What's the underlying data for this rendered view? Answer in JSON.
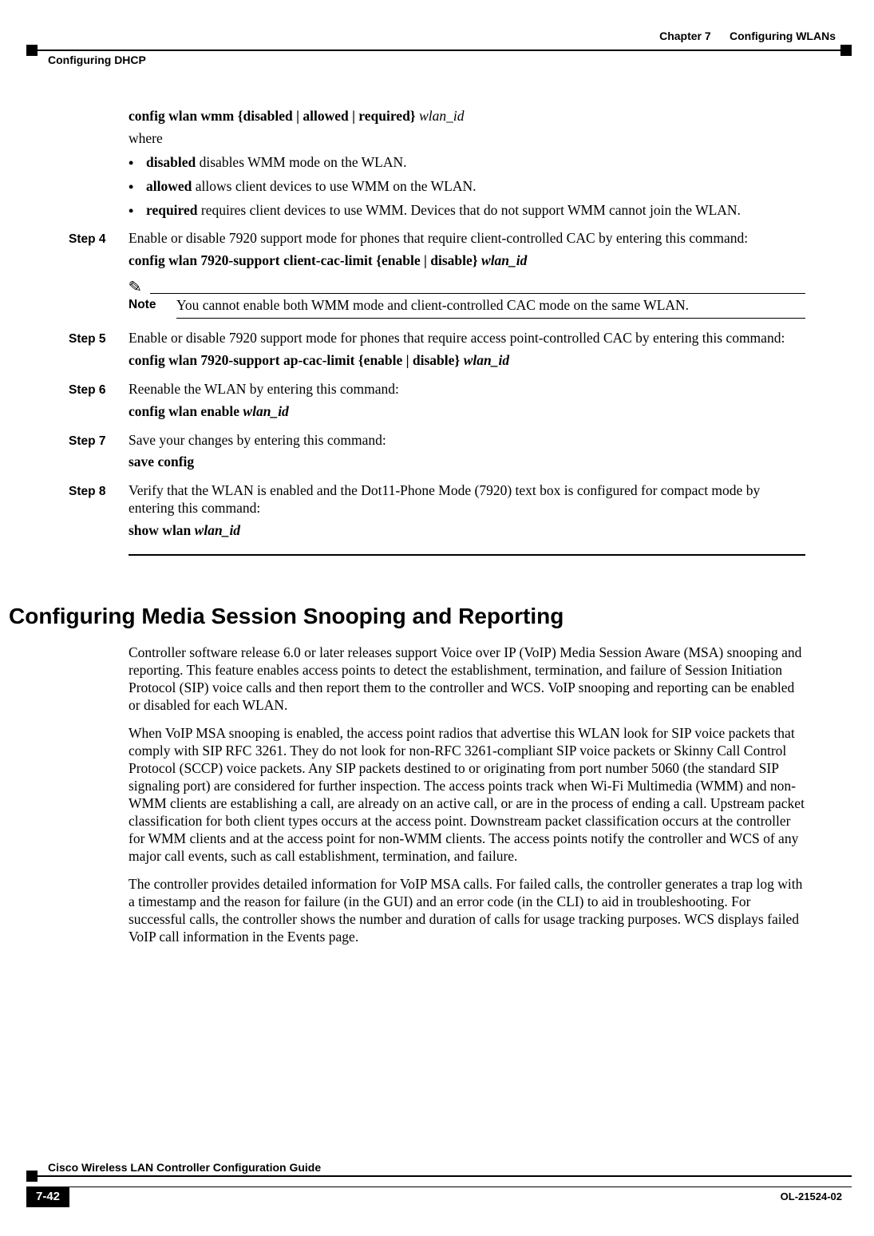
{
  "header": {
    "chapter": "Chapter 7      Configuring WLANs",
    "section": "Configuring DHCP"
  },
  "content": {
    "cmd_wmm_pre": "config wlan wmm",
    "cmd_wmm_opts": " {disabled | allowed | required} ",
    "cmd_wmm_arg": "wlan_id",
    "where": "where",
    "bul1_b": "disabled",
    "bul1_t": " disables WMM mode on the WLAN.",
    "bul2_b": "allowed",
    "bul2_t": " allows client devices to use WMM on the WLAN.",
    "bul3_b": "required",
    "bul3_t": " requires client devices to use WMM. Devices that do not support WMM cannot join the WLAN.",
    "step4_label": "Step 4",
    "step4_text": "Enable or disable 7920 support mode for phones that require client-controlled CAC by entering this command:",
    "step4_cmd_pre": "config wlan 7920-support client-cac-limit",
    "step4_cmd_opts": " {enable | disable} ",
    "step4_cmd_arg": "wlan_id",
    "note_label": "Note",
    "note_text": "You cannot enable both WMM mode and client-controlled CAC mode on the same WLAN.",
    "step5_label": "Step 5",
    "step5_text": "Enable or disable 7920 support mode for phones that require access point-controlled CAC by entering this command:",
    "step5_cmd_pre": "config wlan 7920-support ap-cac-limit",
    "step5_cmd_opts": " {enable | disable} ",
    "step5_cmd_arg": "wlan_id",
    "step6_label": "Step 6",
    "step6_text": "Reenable the WLAN by entering this command:",
    "step6_cmd_pre": "config wlan enable ",
    "step6_cmd_arg": "wlan_id",
    "step7_label": "Step 7",
    "step7_text": "Save your changes by entering this command:",
    "step7_cmd": "save config",
    "step8_label": "Step 8",
    "step8_text": "Verify that the WLAN is enabled and the Dot11-Phone Mode (7920) text box is configured for compact mode by entering this command:",
    "step8_cmd_pre": "show wlan ",
    "step8_cmd_arg": "wlan_id",
    "h2": "Configuring Media Session Snooping and Reporting",
    "p1": "Controller software release 6.0 or later releases support Voice over IP (VoIP) Media Session Aware (MSA) snooping and reporting. This feature enables access points to detect the establishment, termination, and failure of Session Initiation Protocol (SIP) voice calls and then report them to the controller and WCS. VoIP snooping and reporting can be enabled or disabled for each WLAN.",
    "p2": "When VoIP MSA snooping is enabled, the access point radios that advertise this WLAN look for SIP voice packets that comply with SIP RFC 3261. They do not look for non-RFC 3261-compliant SIP voice packets or Skinny Call Control Protocol (SCCP) voice packets. Any SIP packets destined to or originating from port number 5060 (the standard SIP signaling port) are considered for further inspection. The access points track when Wi-Fi Multimedia (WMM) and non-WMM clients are establishing a call, are already on an active call, or are in the process of ending a call. Upstream packet classification for both client types occurs at the access point. Downstream packet classification occurs at the controller for WMM clients and at the access point for non-WMM clients. The access points notify the controller and WCS of any major call events, such as call establishment, termination, and failure.",
    "p3": "The controller provides detailed information for VoIP MSA calls. For failed calls, the controller generates a trap log with a timestamp and the reason for failure (in the GUI) and an error code (in the CLI) to aid in troubleshooting. For successful calls, the controller shows the number and duration of calls for usage tracking purposes. WCS displays failed VoIP call information in the Events page."
  },
  "footer": {
    "guide": "Cisco Wireless LAN Controller Configuration Guide",
    "pagenum": "7-42",
    "ol": "OL-21524-02"
  }
}
